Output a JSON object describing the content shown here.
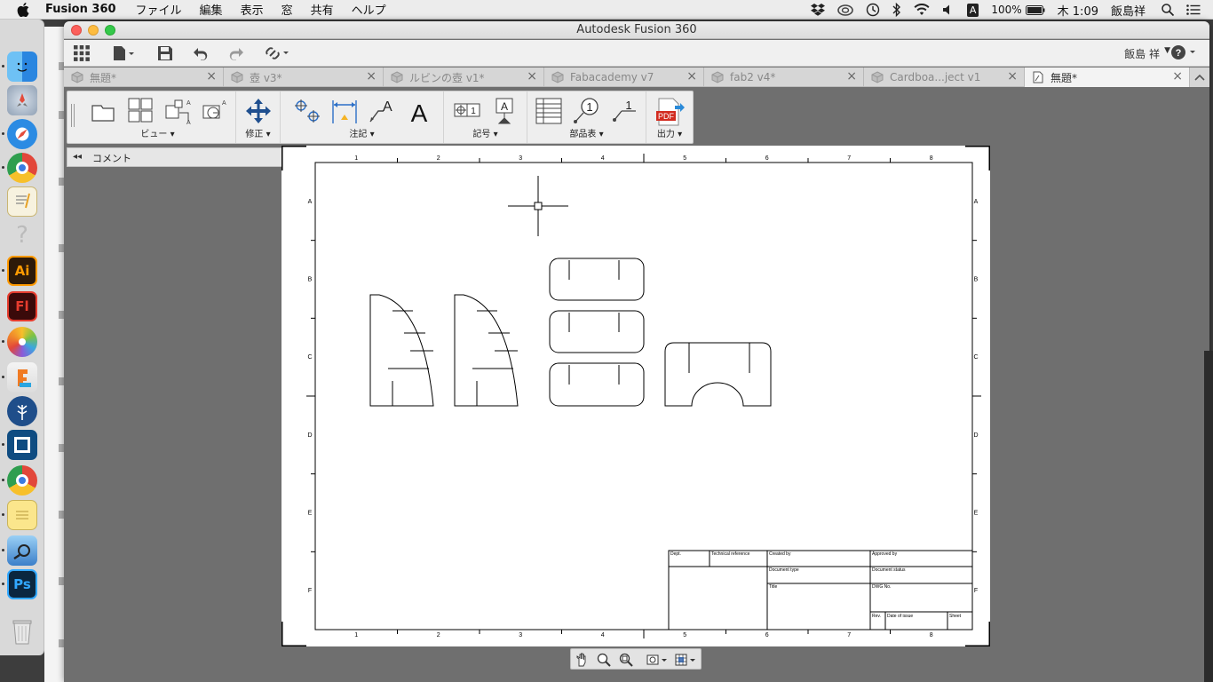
{
  "menubar": {
    "app_name": "Fusion 360",
    "items": [
      "ファイル",
      "編集",
      "表示",
      "窓",
      "共有",
      "ヘルプ"
    ],
    "status": {
      "input_source": "A",
      "battery_percent": "100%",
      "clock": "木 1:09",
      "user_name": "飯島祥"
    },
    "icons": [
      "apple-icon",
      "dropbox-icon",
      "creative-cloud-icon",
      "time-machine-icon",
      "bluetooth-icon",
      "wifi-icon",
      "volume-icon",
      "battery-icon",
      "spotlight-icon",
      "notification-center-icon"
    ]
  },
  "dock": {
    "apps": [
      {
        "name": "finder",
        "color": "#3a8ee6"
      },
      {
        "name": "launchpad",
        "color": "#b7c3d1"
      },
      {
        "name": "safari",
        "color": "#1e7ce0"
      },
      {
        "name": "chrome",
        "color": "#e2473a"
      },
      {
        "name": "textedit",
        "color": "#f3c84b"
      },
      {
        "name": "unknown",
        "color": "#d9d9d9"
      },
      {
        "name": "illustrator",
        "color": "#2d1a09",
        "glyph": "Ai"
      },
      {
        "name": "flash",
        "color": "#3a0a0a",
        "glyph": "Fl"
      },
      {
        "name": "photos",
        "color": "#f6f6f6"
      },
      {
        "name": "fusion-360",
        "color": "#f07a22"
      },
      {
        "name": "sourcetree",
        "color": "#1f4e8a"
      },
      {
        "name": "box-app",
        "color": "#0f4c81"
      },
      {
        "name": "chrome-2",
        "color": "#e2473a"
      },
      {
        "name": "notes",
        "color": "#fbe68c"
      },
      {
        "name": "preview",
        "color": "#4b8ad8"
      },
      {
        "name": "photoshop",
        "color": "#0a2740",
        "glyph": "Ps"
      },
      {
        "name": "trash",
        "color": "#dcdcdc"
      }
    ]
  },
  "window": {
    "title": "Autodesk Fusion 360",
    "user": "飯島 祥",
    "help_icon": "help-icon"
  },
  "tabs": [
    {
      "label": "無題*",
      "active": false
    },
    {
      "label": "壺 v3*",
      "active": false
    },
    {
      "label": "ルビンの壺 v1*",
      "active": false
    },
    {
      "label": "Fabacademy v7",
      "active": false
    },
    {
      "label": "fab2 v4*",
      "active": false
    },
    {
      "label": "Cardboa...ject v1",
      "active": false
    },
    {
      "label": "無題*",
      "active": true
    }
  ],
  "toolbar": {
    "groups": [
      {
        "label": "ビュー ▾"
      },
      {
        "label": "修正 ▾"
      },
      {
        "label": "注記 ▾"
      },
      {
        "label": "記号 ▾"
      },
      {
        "label": "部品表 ▾"
      },
      {
        "label": "出力 ▾"
      }
    ],
    "pdf_label": "PDF"
  },
  "comment_panel": {
    "label": "コメント",
    "collapse_icon": "◂◂",
    "add_icon": "+"
  },
  "drawing": {
    "zone_numbers": [
      "1",
      "2",
      "3",
      "4",
      "5",
      "6",
      "7",
      "8"
    ],
    "zone_letters": [
      "A",
      "B",
      "C",
      "D",
      "E",
      "F"
    ],
    "title_block": {
      "dept": "Dept.",
      "technical_reference": "Technical reference",
      "created_by": "Created by",
      "approved_by": "Approved by",
      "document_type": "Document type",
      "document_status": "Document status",
      "title": "Title",
      "dwg_no": "DWG No.",
      "rev": "Rev.",
      "date_of_issue": "Date of issue",
      "sheet": "Sheet"
    }
  },
  "navbar": {
    "tools": [
      "pan-icon",
      "zoom-icon",
      "zoom-window-icon",
      "display-settings-icon",
      "grid-settings-icon"
    ]
  }
}
